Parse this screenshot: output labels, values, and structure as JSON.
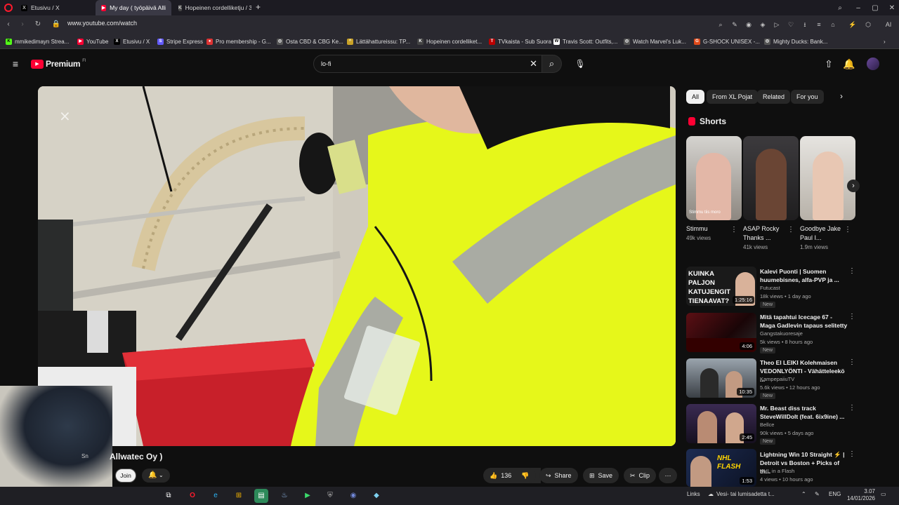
{
  "browser": {
    "tabs": [
      {
        "label": "Etusivu / X",
        "icon": "x-logo-icon"
      },
      {
        "label": "My day ( työpäivä Alli",
        "icon": "youtube-icon"
      },
      {
        "label": "Hopeinen cordelliketju / 3",
        "icon": "kt-icon"
      }
    ],
    "new_tab_glyph": "+",
    "url": "www.youtube.com/watch",
    "bookmarks": [
      {
        "label": "mmikedimayn Strea..."
      },
      {
        "label": "YouTube"
      },
      {
        "label": "Etusivu / X"
      },
      {
        "label": "Stripe Express"
      },
      {
        "label": "Pro membership - G..."
      },
      {
        "label": "Osta CBD & CBG Ke..."
      },
      {
        "label": "Lättähattureissu: TP..."
      },
      {
        "label": "Hopeinen cordelliket..."
      },
      {
        "label": "TVkaista - Sub Suora"
      },
      {
        "label": "Travis Scott: Outfits,..."
      },
      {
        "label": "Watch Marvel's Luk..."
      },
      {
        "label": "G-SHOCK UNISEX -..."
      },
      {
        "label": "Mighty Ducks: Bank..."
      }
    ]
  },
  "youtube": {
    "logo_text": "Premium",
    "logo_sup": "FI",
    "search_value": "lo-fi",
    "video": {
      "channel_partial": "Sn",
      "title_partial": "Allwatec Oy )",
      "join_label": "Join",
      "like_count": "136",
      "share_label": "Share",
      "save_label": "Save",
      "clip_label": "Clip"
    },
    "chips": [
      "All",
      "From XL Pojat",
      "Related",
      "For you"
    ],
    "shorts_heading": "Shorts",
    "shorts": [
      {
        "title": "Stimmu",
        "views": "49k views",
        "caption": "Stimmu tiis moro"
      },
      {
        "title": "ASAP Rocky Thanks ...",
        "views": "41k views"
      },
      {
        "title": "Goodbye Jake Paul I...",
        "views": "1.9m views"
      }
    ],
    "recommendations": [
      {
        "title": "Kalevi Puonti | Suomen huumebisnes, alfa-PVP ja ...",
        "channel": "Futucast",
        "meta": "18k views • 1 day ago",
        "badge": "New",
        "duration": "1:25:16",
        "thumb_text": "KUINKA PALJON KATUJENGIT TIENAAVAT?"
      },
      {
        "title": "Mitä tapahtui Icecage 67 - Maga Gadlevin tapaus selitetty",
        "channel": "Gangstakuoresaje",
        "meta": "5k views • 8 hours ago",
        "badge": "New",
        "duration": "4:06"
      },
      {
        "title": "Theo El LEIKI Kolehmaisen VEDONLYÖNTI - Vähätteleekö ...",
        "channel": "KampepaiiuTV",
        "meta": "5.6k views • 12 hours ago",
        "badge": "New",
        "duration": "10:35"
      },
      {
        "title": "Mr. Beast diss track SteveWillDoIt (feat. 6ix9ine) ...",
        "channel": "Bellce",
        "meta": "90k views • 5 days ago",
        "badge": "New",
        "duration": "2:45"
      },
      {
        "title": "Lightning Win 10 Straight ⚡ | Detroit vs Boston + Picks of th...",
        "channel": "NHL in a Flash",
        "meta": "4 views • 10 hours ago",
        "badge": "",
        "duration": "1:53",
        "thumb_text": "NHL FLASH"
      }
    ]
  },
  "taskbar": {
    "links_label": "Links",
    "weather_text": "Vesi- tai lumisadetta t...",
    "lang": "ENG",
    "time": "3.07",
    "date": "14/01/2026"
  },
  "colors": {
    "yt_red": "#ff0033",
    "bg": "#0f0f0f",
    "chip_bg": "#272727",
    "vest_yellow": "#e6f71a"
  }
}
